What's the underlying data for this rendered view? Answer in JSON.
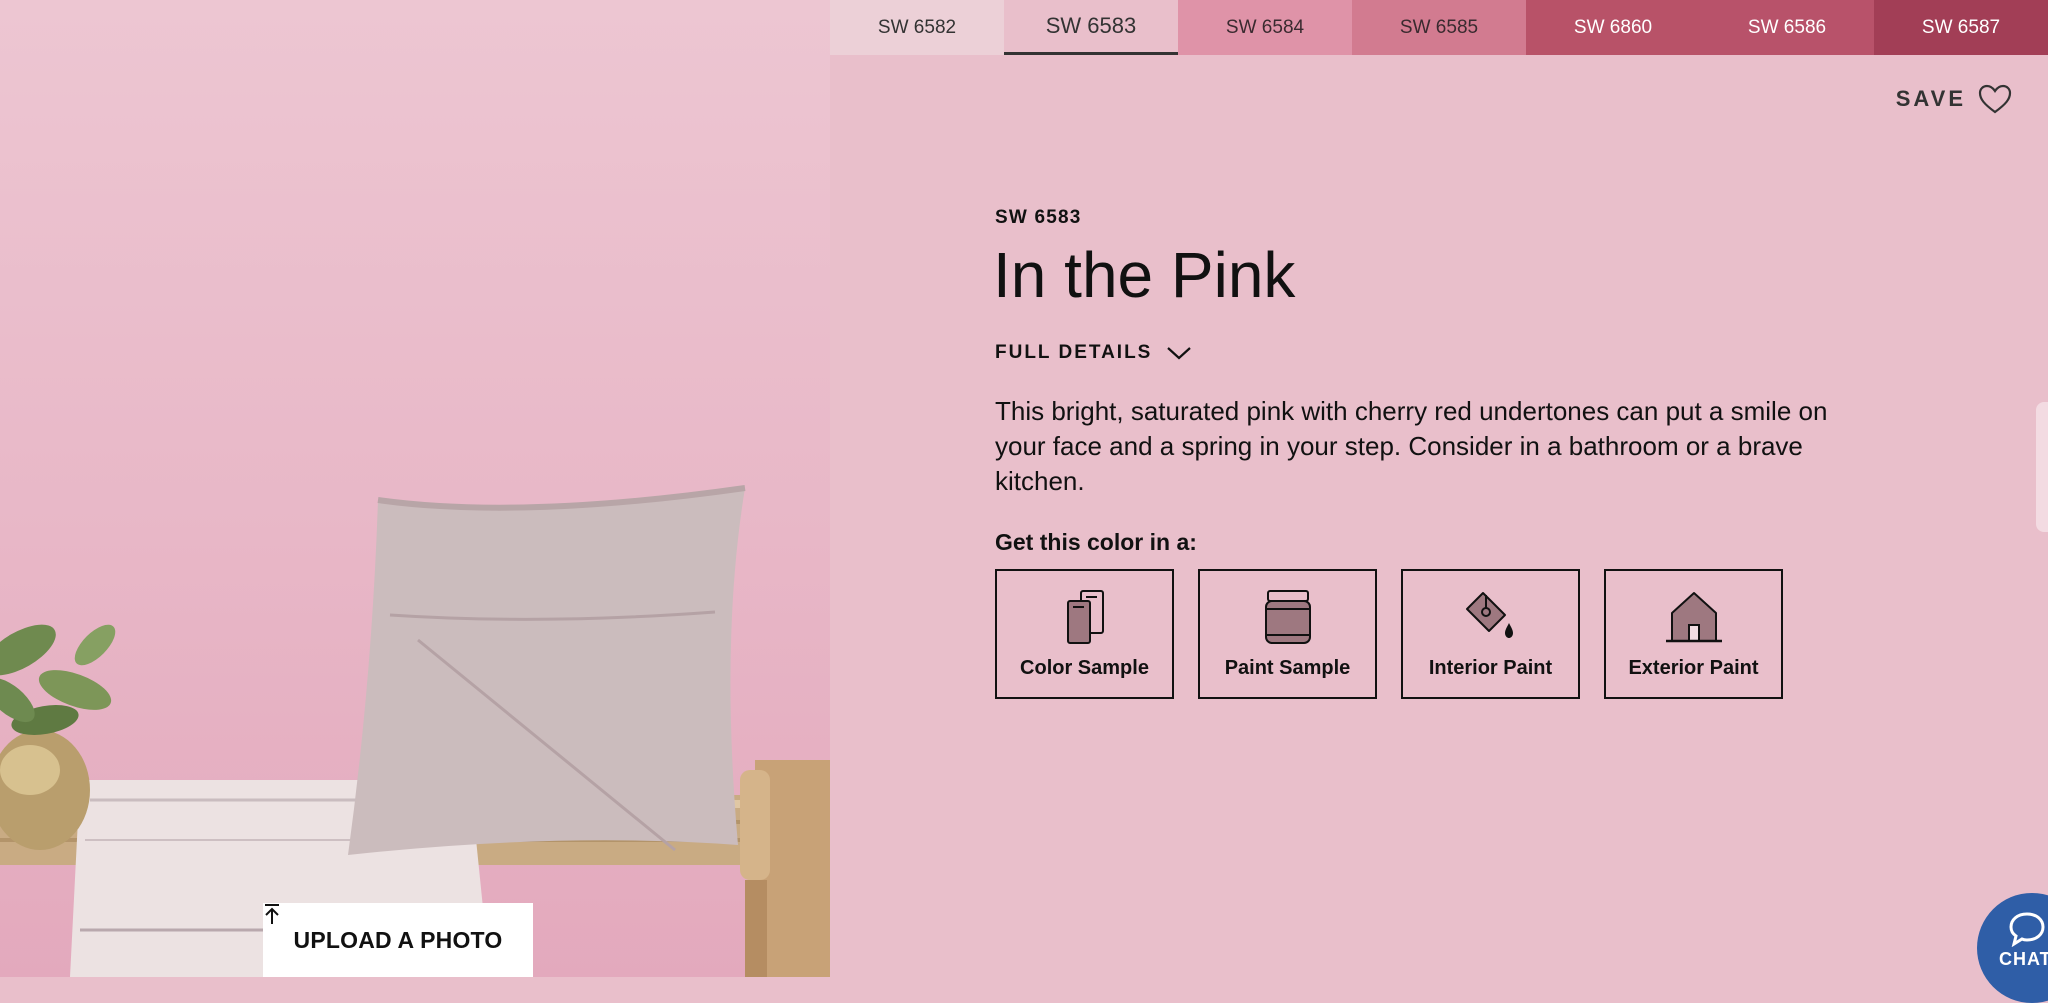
{
  "swatches": [
    {
      "code": "SW 6582",
      "color": "#ecd0d7",
      "text_color": "#333333",
      "active": false
    },
    {
      "code": "SW 6583",
      "color": "#e9bfcb",
      "text_color": "#333333",
      "active": true
    },
    {
      "code": "SW 6584",
      "color": "#df93a8",
      "text_color": "#3a2a2f",
      "active": false
    },
    {
      "code": "SW 6585",
      "color": "#d27b90",
      "text_color": "#3a2a2f",
      "active": false
    },
    {
      "code": "SW 6860",
      "color": "#b85268",
      "text_color": "#ffffff",
      "active": false
    },
    {
      "code": "SW 6586",
      "color": "#b8526a",
      "text_color": "#ffffff",
      "active": false
    },
    {
      "code": "SW 6587",
      "color": "#a23e56",
      "text_color": "#ffffff",
      "active": false
    }
  ],
  "save": {
    "label": "SAVE"
  },
  "color": {
    "code": "SW 6583",
    "name": "In the Pink",
    "full_details_label": "FULL DETAILS",
    "description": "This bright, saturated pink with cherry red undertones can put a smile on your face and a spring in your step. Consider in a bathroom or a brave kitchen."
  },
  "get_label": "Get this color in a:",
  "options": [
    {
      "label": "Color Sample",
      "icon": "color-sample-icon"
    },
    {
      "label": "Paint Sample",
      "icon": "paint-jar-icon"
    },
    {
      "label": "Interior Paint",
      "icon": "paint-bucket-icon"
    },
    {
      "label": "Exterior Paint",
      "icon": "house-icon"
    }
  ],
  "photo": {
    "upload_label": "UPLOAD A PHOTO"
  },
  "chat": {
    "label": "CHAT"
  }
}
